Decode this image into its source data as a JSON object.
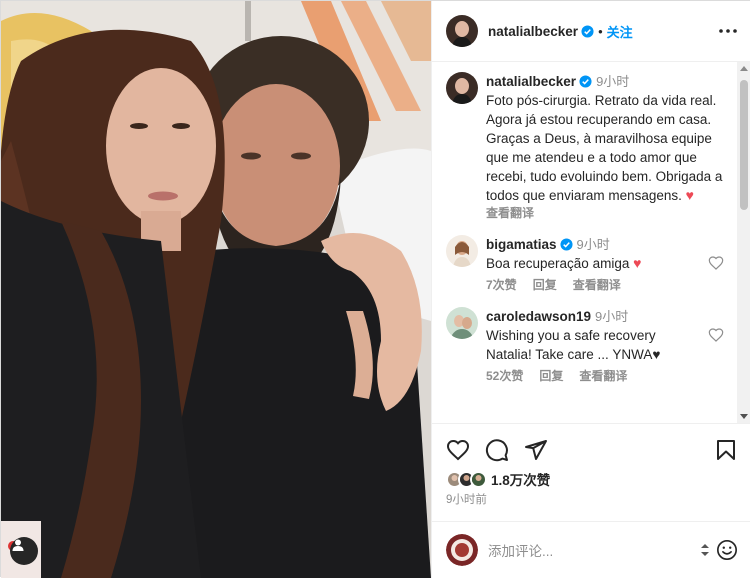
{
  "header": {
    "username": "natalialbecker",
    "separator": "•",
    "follow_label": "关注"
  },
  "caption": {
    "username": "natalialbecker",
    "time": "9小时",
    "text": "Foto pós-cirurgia. Retrato da vida real. Agora já estou recuperando em casa. Graças a Deus, à maravilhosa equipe que me atendeu e a todo amor que recebi, tudo evoluindo bem. Obrigada a todos que enviaram mensagens.",
    "emoji": "♥",
    "translate_label": "查看翻译"
  },
  "comments": [
    {
      "username": "bigamatias",
      "verified": true,
      "time": "9小时",
      "text": "Boa recuperação amiga",
      "emoji": "♥",
      "likes": "7次赞",
      "reply_label": "回复",
      "translate_label": "查看翻译"
    },
    {
      "username": "caroledawson19",
      "verified": false,
      "time": "9小时",
      "text": "Wishing you a safe recovery Natalia! Take care ... YNWA♥",
      "likes": "52次赞",
      "reply_label": "回复",
      "translate_label": "查看翻译"
    }
  ],
  "likes": {
    "count": "1.8万次赞"
  },
  "post_time": "9小时前",
  "add_comment": {
    "placeholder": "添加评论..."
  },
  "colors": {
    "accent_blue": "#0095f6",
    "heart_red": "#ed4956",
    "muted_text": "#8e8e8e",
    "border": "#efefef"
  },
  "icons": {
    "header_more": "more-horizontal-icon",
    "verified": "verified-badge-icon",
    "like": "heart-outline-icon",
    "comment": "comment-bubble-icon",
    "share": "paper-plane-icon",
    "save": "bookmark-icon",
    "emoji": "smiley-icon",
    "photo_user": "person-tag-icon"
  }
}
